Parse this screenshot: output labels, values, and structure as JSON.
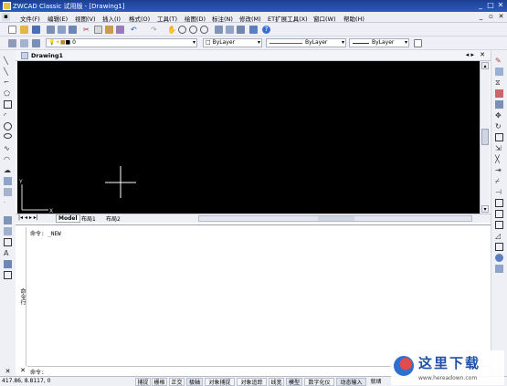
{
  "window": {
    "title": "ZWCAD Classic 试用版 - [Drawing1]"
  },
  "menu": [
    "文件(F)",
    "编辑(E)",
    "视图(V)",
    "插入(I)",
    "格式(O)",
    "工具(T)",
    "绘图(D)",
    "标注(N)",
    "修改(M)",
    "ET扩展工具(X)",
    "窗口(W)",
    "帮助(H)"
  ],
  "layers": {
    "layer_value": "0"
  },
  "properties": {
    "color": "ByLayer",
    "linetype": "ByLayer",
    "lineweight": "ByLayer"
  },
  "document": {
    "tab": "Drawing1"
  },
  "layout_tabs": [
    "Model",
    "布局1",
    "布局2"
  ],
  "command": {
    "history": "命令: _NEW",
    "prompt": "命令:"
  },
  "palette": {
    "label": "命令行"
  },
  "status": {
    "coords": "417.86, 8.8117, 0",
    "buttons": [
      "捕捉",
      "栅格",
      "正交",
      "极轴",
      "对象捕捉",
      "对象追踪",
      "线宽",
      "模型",
      "数字化仪",
      "动态输入",
      "就绪"
    ]
  },
  "colors": {
    "titlebar": "#1f48a8",
    "canvas": "#000000",
    "accent": "#3a6fd8"
  },
  "watermark": {
    "text": "这里下载",
    "url": "www.hereadown.com"
  }
}
